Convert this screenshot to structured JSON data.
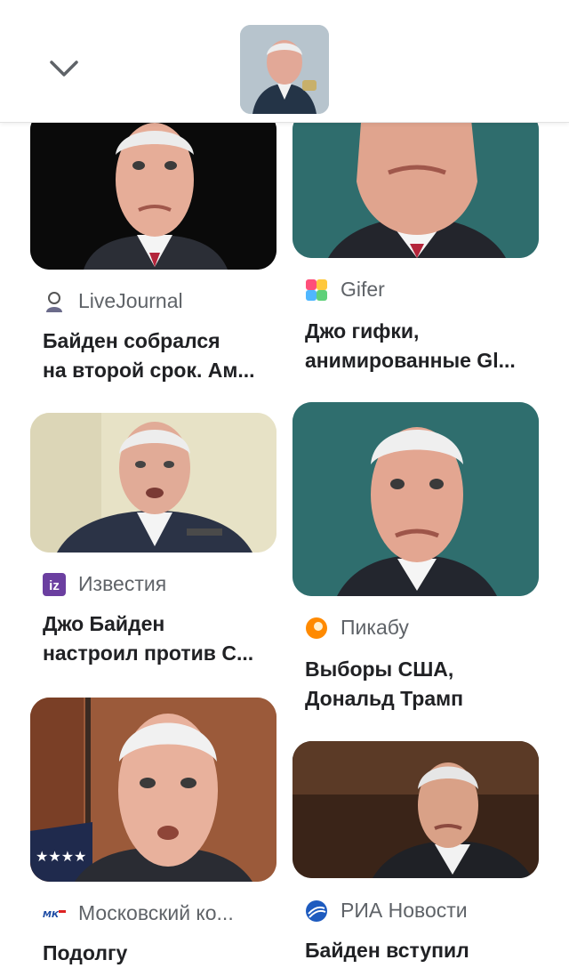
{
  "header": {
    "back_icon": "chevron-down-icon",
    "thumbnail_icon": "image-thumbnail"
  },
  "results": [
    {
      "source": "LiveJournal",
      "source_icon": "livejournal-icon",
      "title_line1": "Байден собрался",
      "title_line2": "на второй срок. Ам..."
    },
    {
      "source": "Gifer",
      "source_icon": "gifer-icon",
      "title_line1": "Джо гифки,",
      "title_line2": "анимированные Gl..."
    },
    {
      "source": "Известия",
      "source_icon": "izvestia-icon",
      "title_line1": "Джо Байден",
      "title_line2": "настроил против С..."
    },
    {
      "source": "Пикабу",
      "source_icon": "pikabu-icon",
      "title_line1": "Выборы США,",
      "title_line2": "Дональд Трамп"
    },
    {
      "source": "Московский ко...",
      "source_icon": "mk-icon",
      "title_line1": "Подолгу",
      "title_line2": ""
    },
    {
      "source": "РИА Новости",
      "source_icon": "ria-icon",
      "title_line1": "Байден вступил",
      "title_line2": ""
    }
  ],
  "colors": {
    "text": "#202124",
    "source": "#5f6368",
    "divider": "#e3e3e3"
  }
}
